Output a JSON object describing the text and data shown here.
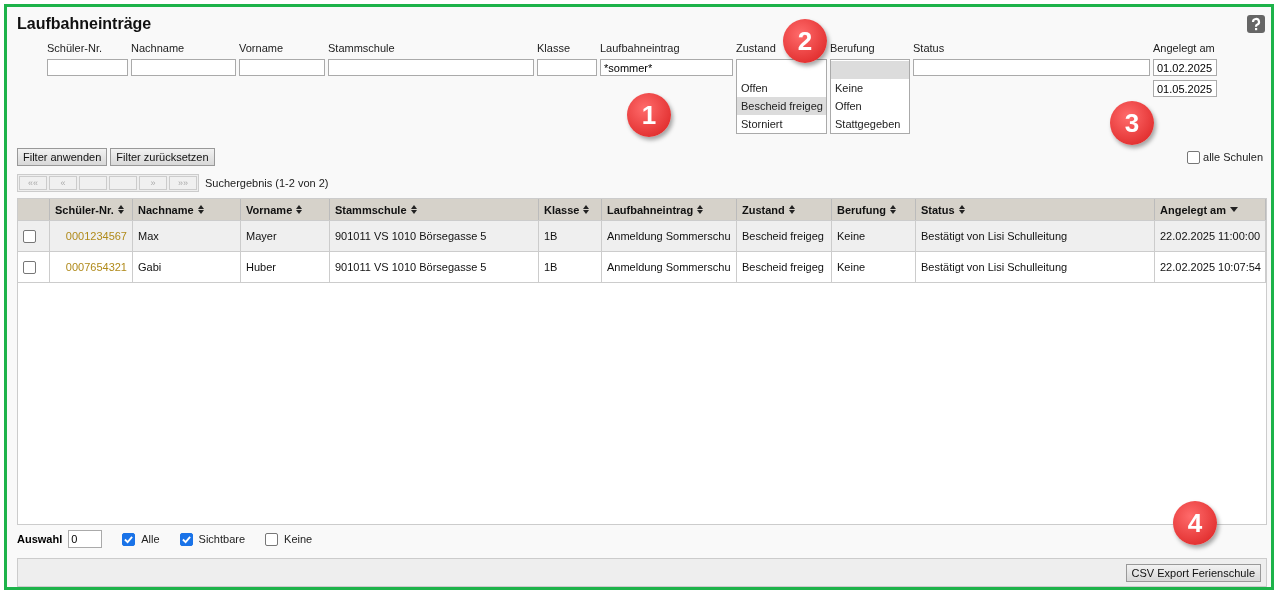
{
  "title": "Laufbahneinträge",
  "filters": [
    {
      "kind": "text",
      "label": "Schüler-Nr."
    },
    {
      "kind": "text",
      "label": "Nachname"
    },
    {
      "kind": "text",
      "label": "Vorname"
    },
    {
      "kind": "text",
      "label": "Stammschule"
    },
    {
      "kind": "text",
      "label": "Klasse"
    },
    {
      "kind": "text",
      "label": "Laufbahneintrag",
      "value": "*sommer*"
    },
    {
      "kind": "listbox",
      "label": "Zustand",
      "options": [
        {
          "selected": false
        },
        {
          "label": "Offen",
          "selected": false
        },
        {
          "label": "Bescheid freigeg",
          "selected": true
        },
        {
          "label": "Storniert",
          "selected": false
        }
      ]
    },
    {
      "kind": "listbox",
      "label": "Berufung",
      "options": [
        {
          "selected": true
        },
        {
          "label": "Keine",
          "selected": false
        },
        {
          "label": "Offen",
          "selected": false
        },
        {
          "label": "Stattgegeben",
          "selected": false
        }
      ]
    },
    {
      "kind": "text",
      "label": "Status"
    },
    {
      "kind": "dates",
      "label": "Angelegt am",
      "values": [
        "01.02.2025",
        "01.05.2025"
      ]
    }
  ],
  "filter_buttons": [
    "Filter anwenden",
    "Filter zurücksetzen"
  ],
  "all_schools": {
    "label": "alle Schulen",
    "checked": false
  },
  "pager": {
    "buttons": [
      {
        "label": "««",
        "disabled": true
      },
      {
        "label": "«",
        "disabled": true
      },
      {
        "disabled": true
      },
      {
        "disabled": true
      },
      {
        "label": "»",
        "disabled": true
      },
      {
        "label": "»»",
        "disabled": true
      }
    ],
    "result": "Suchergebnis (1-2 von 2)"
  },
  "table": {
    "columns": [
      {
        "label": "Schüler-Nr.",
        "sorted": false
      },
      {
        "label": "Nachname",
        "sorted": false
      },
      {
        "label": "Vorname",
        "sorted": false
      },
      {
        "label": "Stammschule",
        "sorted": false
      },
      {
        "label": "Klasse",
        "sorted": false
      },
      {
        "label": "Laufbahneintrag",
        "sorted": false
      },
      {
        "label": "Zustand",
        "sorted": false
      },
      {
        "label": "Berufung",
        "sorted": false
      },
      {
        "label": "Status",
        "sorted": false
      },
      {
        "label": "Angelegt am",
        "sorted": true
      }
    ],
    "rows": [
      {
        "checked": false,
        "highlighted": true,
        "cells": [
          "0001234567",
          "Max",
          "Mayer",
          "901011 VS 1010 Börsegasse 5",
          "1B",
          "Anmeldung Sommerschu",
          "Bescheid freigeg",
          "Keine",
          "Bestätigt von Lisi Schulleitung",
          "22.02.2025 11:00:00"
        ]
      },
      {
        "checked": false,
        "highlighted": false,
        "cells": [
          "0007654321",
          "Gabi",
          "Huber",
          "901011 VS 1010 Börsegasse 5",
          "1B",
          "Anmeldung Sommerschu",
          "Bescheid freigeg",
          "Keine",
          "Bestätigt von Lisi Schulleitung",
          "22.02.2025 10:07:54"
        ]
      }
    ]
  },
  "selection": {
    "label": "Auswahl",
    "value": "0",
    "options": [
      {
        "label": "Alle",
        "checked": true
      },
      {
        "label": "Sichtbare",
        "checked": true
      },
      {
        "label": "Keine",
        "checked": false
      }
    ]
  },
  "export_button": "CSV Export Ferienschule",
  "annotations": [
    "1",
    "2",
    "3",
    "4"
  ]
}
